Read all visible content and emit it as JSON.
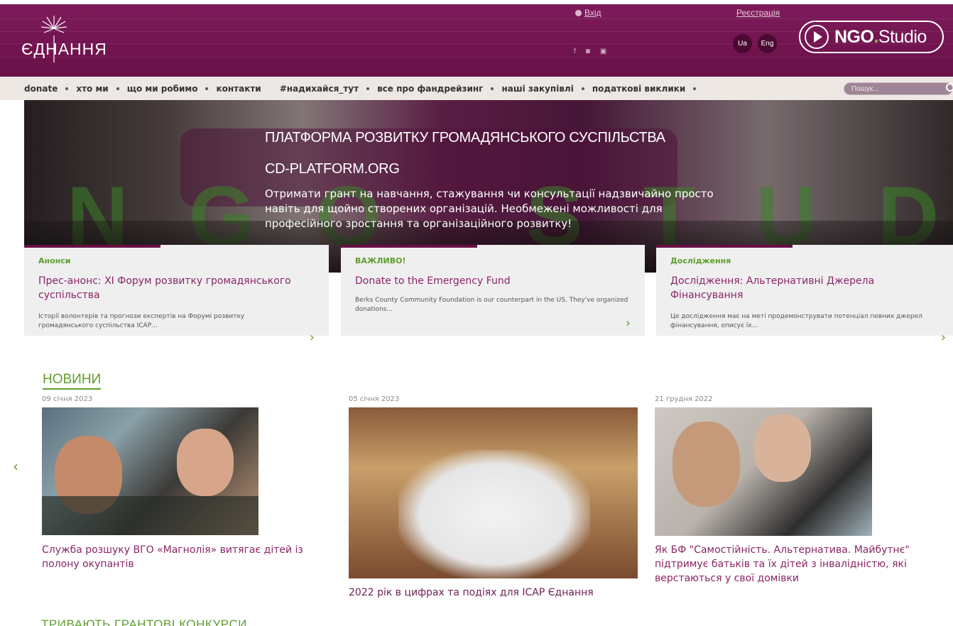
{
  "header": {
    "logo_text": "ЄДНАННЯ",
    "login": "Вхід",
    "register": "Реєстрація",
    "social": [
      "f",
      "◙",
      "▣"
    ],
    "langs": [
      "Ua",
      "Eng"
    ],
    "ngo_bold": "NGO",
    "ngo_dot": ".",
    "ngo_rest": "Studio"
  },
  "nav": {
    "items": [
      "donate",
      "хто ми",
      "що ми робимо",
      "контакти"
    ],
    "items2": [
      "#надихайся_тут",
      "все про фандрейзинг",
      "наші закупівлі",
      "податкові виклики"
    ],
    "search_placeholder": "Пошук..."
  },
  "hero": {
    "title": "ПЛАТФОРМА РОЗВИТКУ ГРОМАДЯНСЬКОГО СУСПІЛЬСТВА",
    "site": "CD-PLATFORM.ORG",
    "desc": "Отримати грант на навчання, стажування чи консультації надзвичайно просто навіть для щойно створених організацій. Необмежені можливості для професійного зростання та організаційного розвитку!",
    "bg_text": "NGO STUDIO.UA"
  },
  "cards": [
    {
      "cat": "Анонси",
      "title": "Прес-анонс: ХІ Форум розвитку громадянського суспільства",
      "text": "Історії волонтерів та прогнози експертів на Форумі розвитку громадянського суспільства ІСАР..."
    },
    {
      "cat": "ВАЖЛИВО!",
      "title": "Donate to the Emergency Fund",
      "text": "Berks County Community Foundation is our counterpart in the US. They've organized donations..."
    },
    {
      "cat": "Дослідження",
      "title": "Дослідження: Альтернативні Джерела Фінансування",
      "text": "Це дослідження має на меті продемонструвати потенціал певних джерел фінансування, описує їх..."
    }
  ],
  "news": {
    "heading": "НОВИНИ",
    "items": [
      {
        "date": "09 січня 2023",
        "title": "Служба розшуку ВГО «Магнолія» витягає дітей із полону окупантів"
      },
      {
        "date": "05 січня 2023",
        "title": "2022 рік в цифрах та подіях для ІСАР Єднання"
      },
      {
        "date": "21 грудня 2022",
        "title": "Як БФ \"Самостійність. Альтернатива. Майбутнє\" підтримує батьків та їх дітей з інвалідністю, які верстаються у свої домівки"
      }
    ]
  },
  "next_section_heading": "ТРИВАЮТЬ ГРАНТОВІ КОНКУРСИ",
  "colors": {
    "brand": "#6b0f47",
    "accent": "#5f9e2f",
    "link": "#8a2566"
  }
}
